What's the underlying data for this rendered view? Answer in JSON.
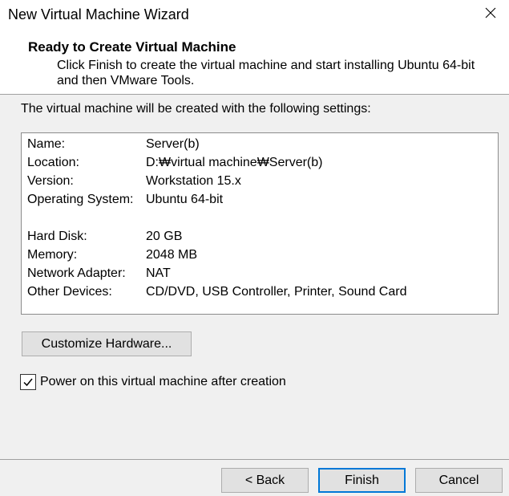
{
  "window": {
    "title": "New Virtual Machine Wizard",
    "close_icon": "close-icon"
  },
  "header": {
    "title": "Ready to Create Virtual Machine",
    "description": [
      "Click Finish to create the virtual machine and start installing Ubuntu 64-bit",
      "and then VMware Tools."
    ]
  },
  "summary": {
    "intro": "The virtual machine will be created with the following settings:",
    "general": [
      {
        "label": "Name:",
        "value": "Server(b)"
      },
      {
        "label": "Location:",
        "value": "D:₩virtual machine₩Server(b)"
      },
      {
        "label": "Version:",
        "value": "Workstation 15.x"
      },
      {
        "label": "Operating System:",
        "value": "Ubuntu 64-bit"
      }
    ],
    "hardware": [
      {
        "label": "Hard Disk:",
        "value": "20 GB"
      },
      {
        "label": "Memory:",
        "value": "2048 MB"
      },
      {
        "label": "Network Adapter:",
        "value": "NAT"
      },
      {
        "label": "Other Devices:",
        "value": "CD/DVD, USB Controller, Printer, Sound Card"
      }
    ]
  },
  "customize_button": {
    "label": "Customize Hardware..."
  },
  "power_on": {
    "label": "Power on this virtual machine after creation",
    "checked": true,
    "icon": "checkmark-icon"
  },
  "footer": {
    "back_label": "< Back",
    "finish_label": "Finish",
    "cancel_label": "Cancel"
  },
  "colors": {
    "accent": "#0078d7",
    "window-background": "#f0f0f0",
    "header-background": "#ffffff",
    "button-face": "#e1e1e1",
    "button-border": "#adadad",
    "divider": "#a0a0a0"
  }
}
